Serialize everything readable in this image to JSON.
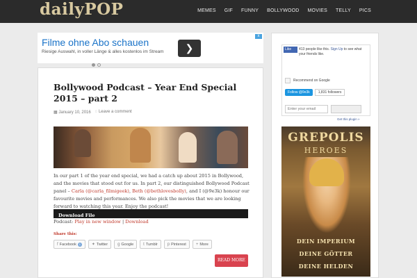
{
  "header": {
    "logo": "dailyPOP",
    "nav": [
      "MEMES",
      "GIF",
      "FUNNY",
      "BOLLYWOOD",
      "MOVIES",
      "TELLY",
      "PICS"
    ]
  },
  "ad_banner": {
    "title": "Filme ohne Abo schauen",
    "subtitle": "Riesige Auswahl, in voller Länge & alles kostenlos im Stream",
    "arrow": "❯",
    "close": "x"
  },
  "post": {
    "title": "Bollywood Podcast – Year End Special 2015 – part 2",
    "date": "January 10, 2016",
    "comment_link": "Leave a comment",
    "body_1": "In our part 1 of the year end special, we had a catch up about 2015 in Bollywood, and the movies that stood out for us. In part 2, our distinguished Bollywood Podcast panel –",
    "link_carla": "Carla (@carla_filmigeek)",
    "sep_1": ",",
    "link_beth": "Beth (@bethlovesbolly)",
    "body_2": ", and I (@9e3k) honour our favourite movies and performances. We also pick the movies that we are looking forward to watching this year. Enjoy the podcast!",
    "player_label": "Download File",
    "podcast_prefix": "Podcast:",
    "play_link": "Play in new window",
    "sep_2": "|",
    "download_link": "Download",
    "share_label": "Share this:",
    "share_buttons": [
      "Facebook",
      "Twitter",
      "Google",
      "Tumblr",
      "Pinterest",
      "More"
    ],
    "facebook_count": "1",
    "read_more": "READ MORE"
  },
  "sidebar": {
    "fb_like": "Like",
    "fb_text_prefix": "413 people like this.",
    "fb_signup": "Sign Up",
    "fb_text_suffix": "to see what your friends like.",
    "google_label": "Recommend on Google",
    "twitter_follow": "Follow @9e3k",
    "twitter_count": "1,831 followers",
    "email_placeholder": "Enter your email",
    "plugin_link": "Get this plugin »"
  },
  "side_ad": {
    "brand": "GREPOLIS",
    "subtitle": "HEROES",
    "line1": "DEIN IMPERIUM",
    "line2": "DEINE GÖTTER",
    "line3": "DEINE HELDEN"
  }
}
